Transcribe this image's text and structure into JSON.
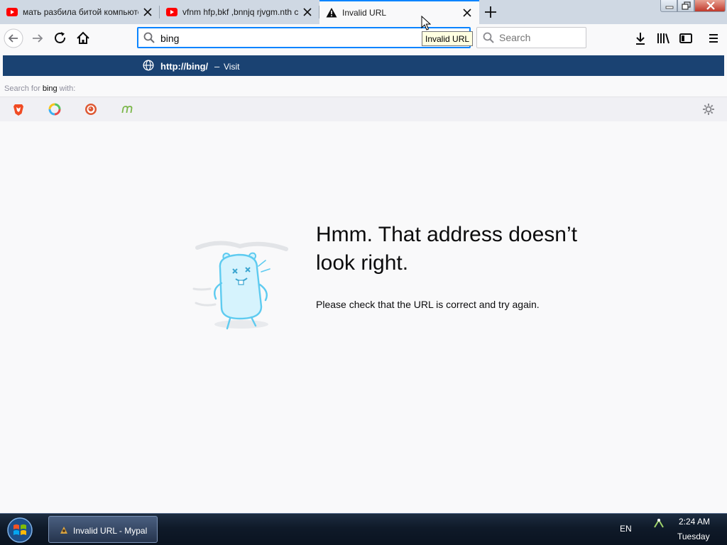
{
  "tabs": [
    {
      "title": "мать разбила битой компьютер",
      "icon": "youtube-icon"
    },
    {
      "title": "vfnm hfp,bkf ,bnnjq rjvgm.nth c",
      "icon": "youtube-icon"
    },
    {
      "title": "Invalid URL",
      "icon": "warning-icon"
    }
  ],
  "urlbar": {
    "value": "bing",
    "search_placeholder": "Search"
  },
  "tooltip": "Invalid URL",
  "popup": {
    "visit_url": "http://bing/",
    "visit_dash": "–",
    "visit_action": "Visit",
    "search_prefix": "Search for ",
    "search_term": "bing",
    "search_suffix": " with:",
    "engines": [
      "brave-icon",
      "qwant-icon",
      "duckduckgo-icon",
      "mojeek-icon"
    ]
  },
  "error": {
    "title": "Hmm. That address doesn’t look right.",
    "description": "Please check that the URL is correct and try again."
  },
  "taskbar": {
    "task_label": "Invalid URL - Mypal",
    "language": "EN",
    "time": "2:24 AM",
    "day": "Tuesday"
  },
  "colors": {
    "accent": "#0a84ff",
    "visit_row": "#1a4272",
    "illustration": "#5ecbf0"
  }
}
